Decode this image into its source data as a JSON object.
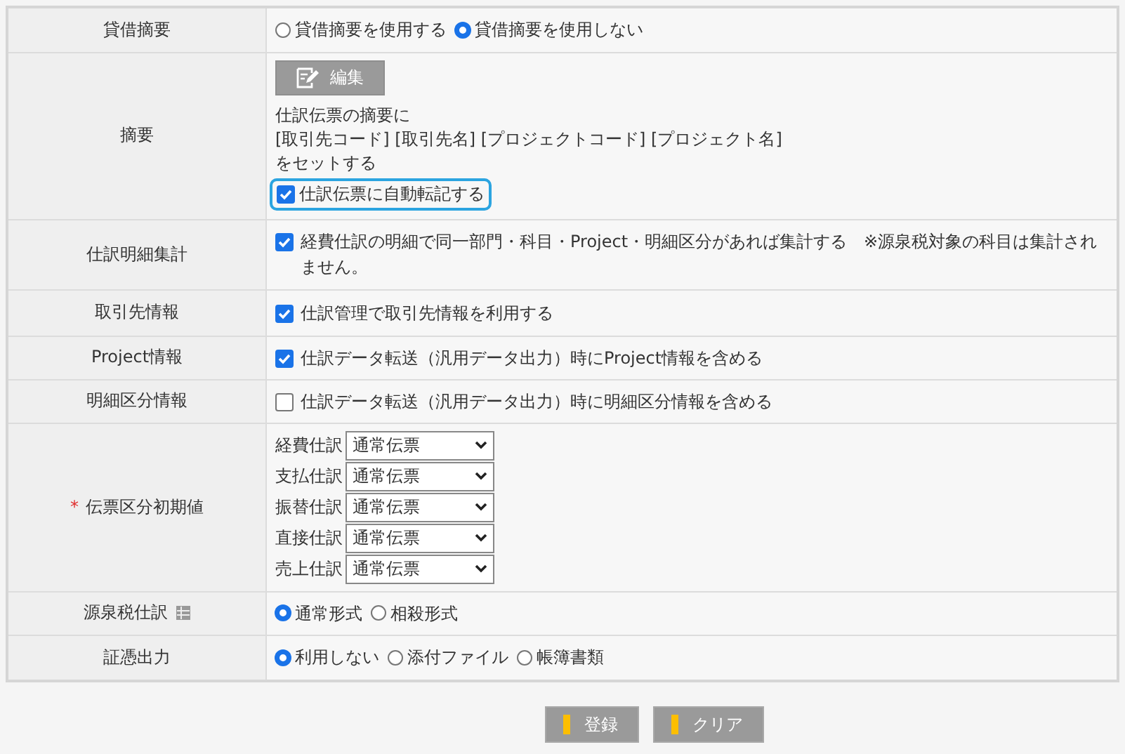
{
  "rows": [
    {
      "label": "貸借摘要",
      "kind": "radio",
      "options": [
        {
          "label": "貸借摘要を使用する",
          "selected": false
        },
        {
          "label": "貸借摘要を使用しない",
          "selected": true
        }
      ]
    },
    {
      "label": "摘要",
      "kind": "summary",
      "button": "編集",
      "lines": [
        "仕訳伝票の摘要に",
        "[取引先コード] [取引先名] [プロジェクトコード] [プロジェクト名]",
        "をセットする"
      ],
      "checkbox": {
        "label": "仕訳伝票に自動転記する",
        "checked": true,
        "focused": true
      }
    },
    {
      "label": "仕訳明細集計",
      "kind": "checkbox",
      "options": [
        {
          "label": "経費仕訳の明細で同一部門・科目・Project・明細区分があれば集計する　※源泉税対象の科目は集計されません。",
          "checked": true
        }
      ]
    },
    {
      "label": "取引先情報",
      "kind": "checkbox",
      "options": [
        {
          "label": "仕訳管理で取引先情報を利用する",
          "checked": true
        }
      ]
    },
    {
      "label": "Project情報",
      "kind": "checkbox",
      "options": [
        {
          "label": "仕訳データ転送（汎用データ出力）時にProject情報を含める",
          "checked": true
        }
      ]
    },
    {
      "label": "明細区分情報",
      "kind": "checkbox",
      "options": [
        {
          "label": "仕訳データ転送（汎用データ出力）時に明細区分情報を含める",
          "checked": false
        }
      ]
    },
    {
      "label": "伝票区分初期値",
      "required_mark": "*",
      "kind": "selects",
      "selects": [
        {
          "label": "経費仕訳",
          "value": "通常伝票"
        },
        {
          "label": "支払仕訳",
          "value": "通常伝票"
        },
        {
          "label": "振替仕訳",
          "value": "通常伝票"
        },
        {
          "label": "直接仕訳",
          "value": "通常伝票"
        },
        {
          "label": "売上仕訳",
          "value": "通常伝票"
        }
      ]
    },
    {
      "label": "源泉税仕訳",
      "info_icon": true,
      "kind": "radio",
      "options": [
        {
          "label": "通常形式",
          "selected": true
        },
        {
          "label": "相殺形式",
          "selected": false
        }
      ]
    },
    {
      "label": "証憑出力",
      "kind": "radio",
      "options": [
        {
          "label": "利用しない",
          "selected": true
        },
        {
          "label": "添付ファイル",
          "selected": false
        },
        {
          "label": "帳簿書類",
          "selected": false
        }
      ]
    }
  ],
  "buttons": [
    {
      "label": "登録"
    },
    {
      "label": "クリア"
    }
  ]
}
